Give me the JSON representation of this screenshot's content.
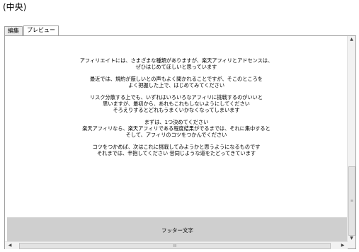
{
  "heading": "(中央)",
  "tabs": [
    {
      "label": "編集",
      "active": false
    },
    {
      "label": "プレビュー",
      "active": true
    }
  ],
  "preview": {
    "paragraphs": [
      "アフィリエイトには、さまざまな種類がありますが、楽天アフィリとアドセンスは、\nぜひはじめてほしいと思っています",
      "最近では、規約が厳しいとの声もよく聞かれることですが、そこのところを\nよく把握した上で、はじめてみてください",
      "リスク分散する上でも、いずれはいろいろなアフィリに挑戦するのがいいと\n思いますが、最初から、あれもこれもしないようにしてください\nそろえりするとどれもうまくいかなくなってしまいます",
      "まずは、1つ決めてください\n楽天アフィリなら、楽天アフィリである程度結果がでるまでは、それに集中すると\nそして、アフィリのコツをつかんでください",
      "コツをつかめば、次はこれに挑戦してみようかと思うようになるものです\nそれまでは、辛抱してください 昔同じような道をたどってきています"
    ],
    "footer_text": "フッター文字"
  },
  "scrollbar": {
    "up_icon": "up-arrow-icon",
    "down_icon": "down-arrow-icon",
    "left_icon": "left-arrow-icon",
    "right_icon": "right-arrow-icon",
    "grip": "≡",
    "hgrip": "III"
  }
}
